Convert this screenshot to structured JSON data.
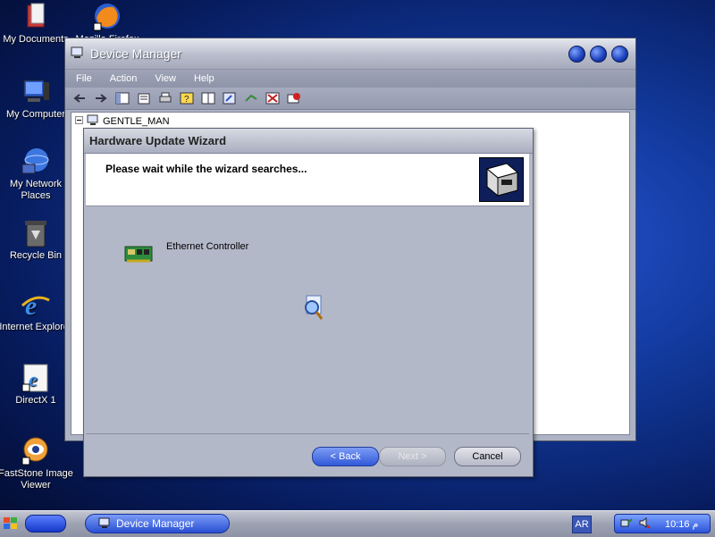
{
  "desktop": {
    "icons": [
      {
        "label": "My Documents"
      },
      {
        "label": "Mozilla Firefox"
      },
      {
        "label": "My Computer"
      },
      {
        "label": "My Network Places"
      },
      {
        "label": "Recycle Bin"
      },
      {
        "label": "Internet Explorer"
      },
      {
        "label": "DirectX 1"
      },
      {
        "label": "FastStone Image Viewer"
      }
    ]
  },
  "device_manager": {
    "title": "Device Manager",
    "menu": [
      "File",
      "Action",
      "View",
      "Help"
    ],
    "tree_root": "GENTLE_MAN"
  },
  "wizard": {
    "title": "Hardware Update Wizard",
    "header_text": "Please wait while the wizard searches...",
    "device_name": "Ethernet Controller",
    "back_label": "< Back",
    "next_label": "Next >",
    "cancel_label": "Cancel"
  },
  "taskbar": {
    "task_label": "Device Manager",
    "language": "AR",
    "clock": "10:16 م"
  },
  "colors": {
    "accent": "#2c55d9",
    "wizard_bg": "#b3b8c8"
  }
}
